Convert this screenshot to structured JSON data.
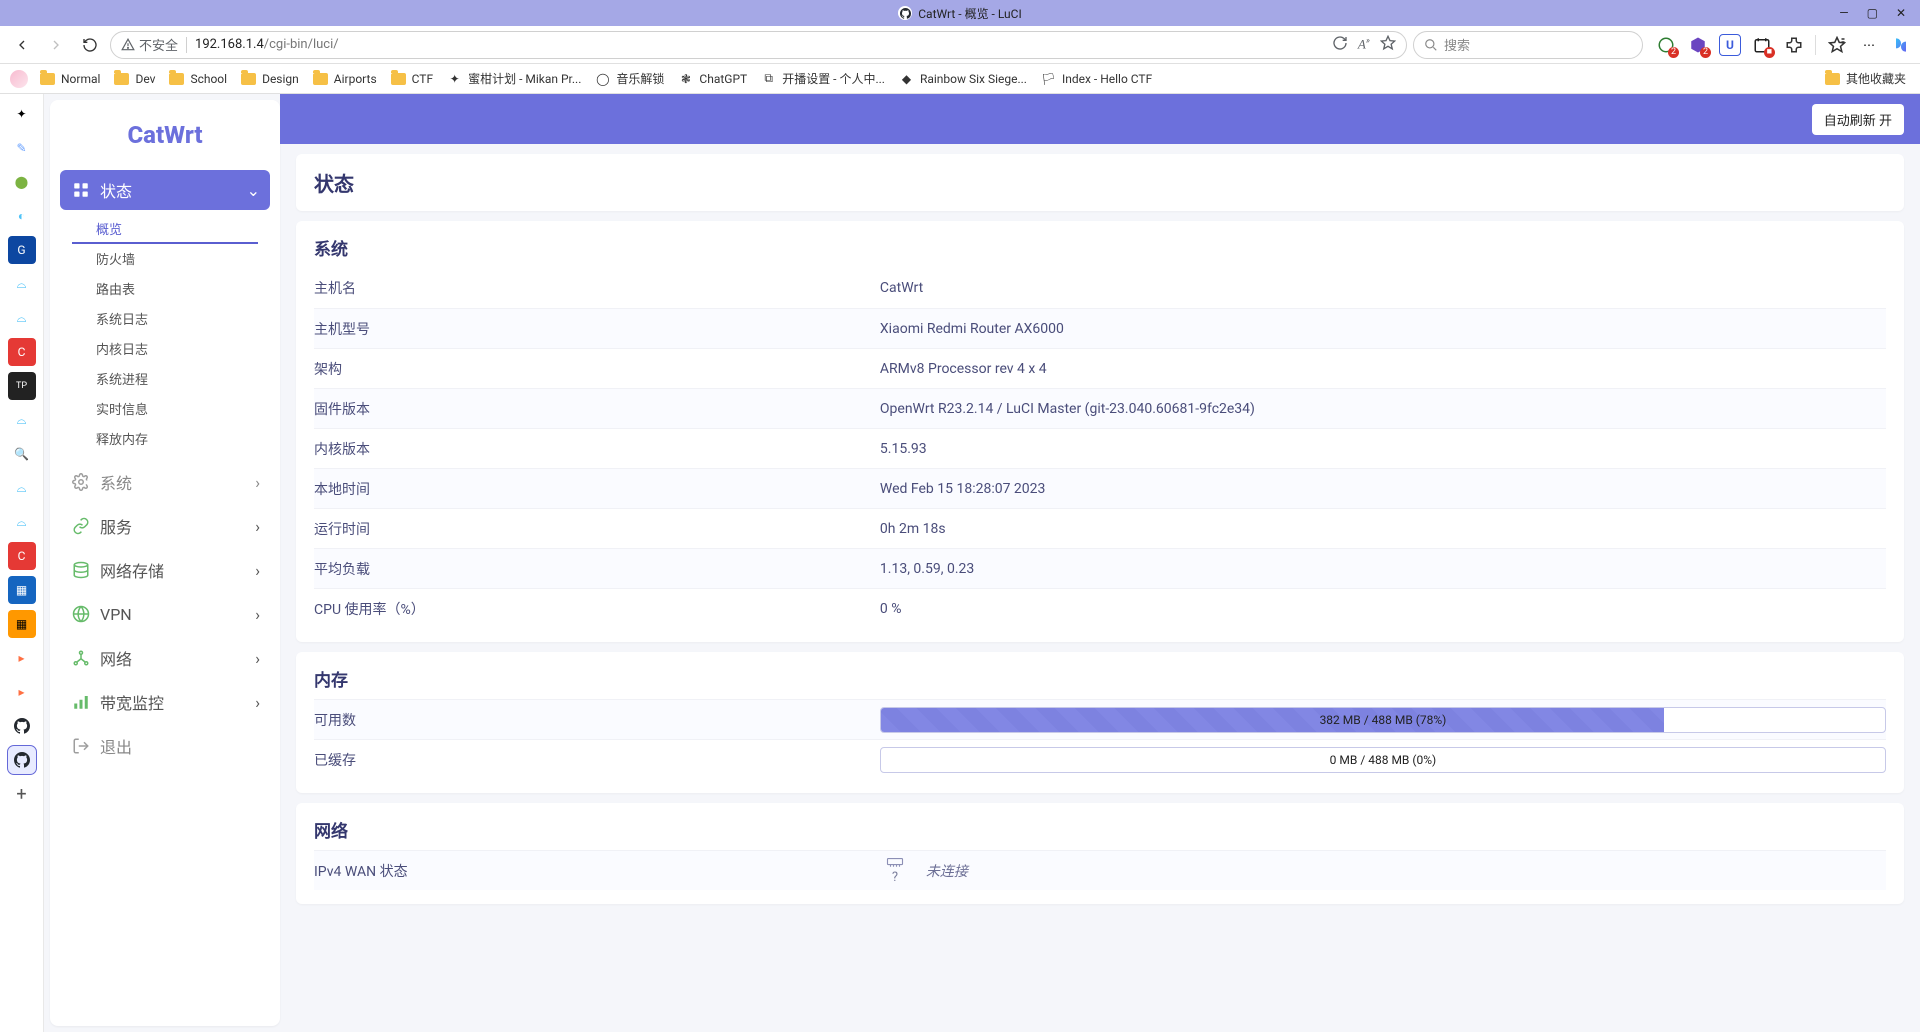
{
  "window": {
    "title": "CatWrt - 概览 - LuCI",
    "controls": {
      "min": "—",
      "max": "▢",
      "close": "✕"
    }
  },
  "browser": {
    "insecure_label": "不安全",
    "url_host": "192.168.1.4",
    "url_path": "/cgi-bin/luci/",
    "search_placeholder": "搜索",
    "bookmarks": [
      {
        "type": "folder",
        "label": "Normal"
      },
      {
        "type": "folder",
        "label": "Dev"
      },
      {
        "type": "folder",
        "label": "School"
      },
      {
        "type": "folder",
        "label": "Design"
      },
      {
        "type": "folder",
        "label": "Airports"
      },
      {
        "type": "folder",
        "label": "CTF"
      },
      {
        "type": "link",
        "icon": "star",
        "label": "蜜柑计划 - Mikan Pr..."
      },
      {
        "type": "link",
        "icon": "circle",
        "label": "音乐解锁"
      },
      {
        "type": "link",
        "icon": "knot",
        "label": "ChatGPT"
      },
      {
        "type": "link",
        "icon": "tv",
        "label": "开播设置 - 个人中..."
      },
      {
        "type": "link",
        "icon": "r6",
        "label": "Rainbow Six Siege..."
      },
      {
        "type": "link",
        "icon": "flag",
        "label": "Index - Hello CTF"
      }
    ],
    "bookmark_overflow": "其他收藏夹"
  },
  "sidebar": {
    "logo": "CatWrt",
    "items": [
      {
        "icon": "grid",
        "label": "状态",
        "active": true,
        "expandable": true
      },
      {
        "icon": "gear",
        "label": "系统",
        "expandable": true
      },
      {
        "icon": "link",
        "label": "服务",
        "expandable": true
      },
      {
        "icon": "disk",
        "label": "网络存储",
        "expandable": true
      },
      {
        "icon": "globe",
        "label": "VPN",
        "expandable": true
      },
      {
        "icon": "net",
        "label": "网络",
        "expandable": true
      },
      {
        "icon": "signal",
        "label": "带宽监控",
        "expandable": true
      },
      {
        "icon": "logout",
        "label": "退出"
      }
    ],
    "subitems": [
      {
        "label": "概览",
        "active": true
      },
      {
        "label": "防火墙"
      },
      {
        "label": "路由表"
      },
      {
        "label": "系统日志"
      },
      {
        "label": "内核日志"
      },
      {
        "label": "系统进程"
      },
      {
        "label": "实时信息"
      },
      {
        "label": "释放内存"
      }
    ]
  },
  "header": {
    "refresh": "自动刷新 开"
  },
  "page": {
    "title": "状态"
  },
  "system": {
    "title": "系统",
    "rows": [
      {
        "k": "主机名",
        "v": "CatWrt"
      },
      {
        "k": "主机型号",
        "v": "Xiaomi Redmi Router AX6000"
      },
      {
        "k": "架构",
        "v": "ARMv8 Processor rev 4 x 4"
      },
      {
        "k": "固件版本",
        "v": "OpenWrt R23.2.14 / LuCI Master (git-23.040.60681-9fc2e34)"
      },
      {
        "k": "内核版本",
        "v": "5.15.93"
      },
      {
        "k": "本地时间",
        "v": "Wed Feb 15 18:28:07 2023"
      },
      {
        "k": "运行时间",
        "v": "0h 2m 18s"
      },
      {
        "k": "平均负载",
        "v": "1.13, 0.59, 0.23"
      },
      {
        "k": "CPU 使用率（%）",
        "v": "0 %"
      }
    ]
  },
  "memory": {
    "title": "内存",
    "available": {
      "k": "可用数",
      "label": "382 MB / 488 MB (78%)",
      "percent": 78
    },
    "cached": {
      "k": "已缓存",
      "label": "0 MB / 488 MB (0%)",
      "percent": 0
    }
  },
  "network": {
    "title": "网络",
    "wan": {
      "k": "IPv4 WAN 状态",
      "status": "未连接",
      "q": "?"
    }
  }
}
